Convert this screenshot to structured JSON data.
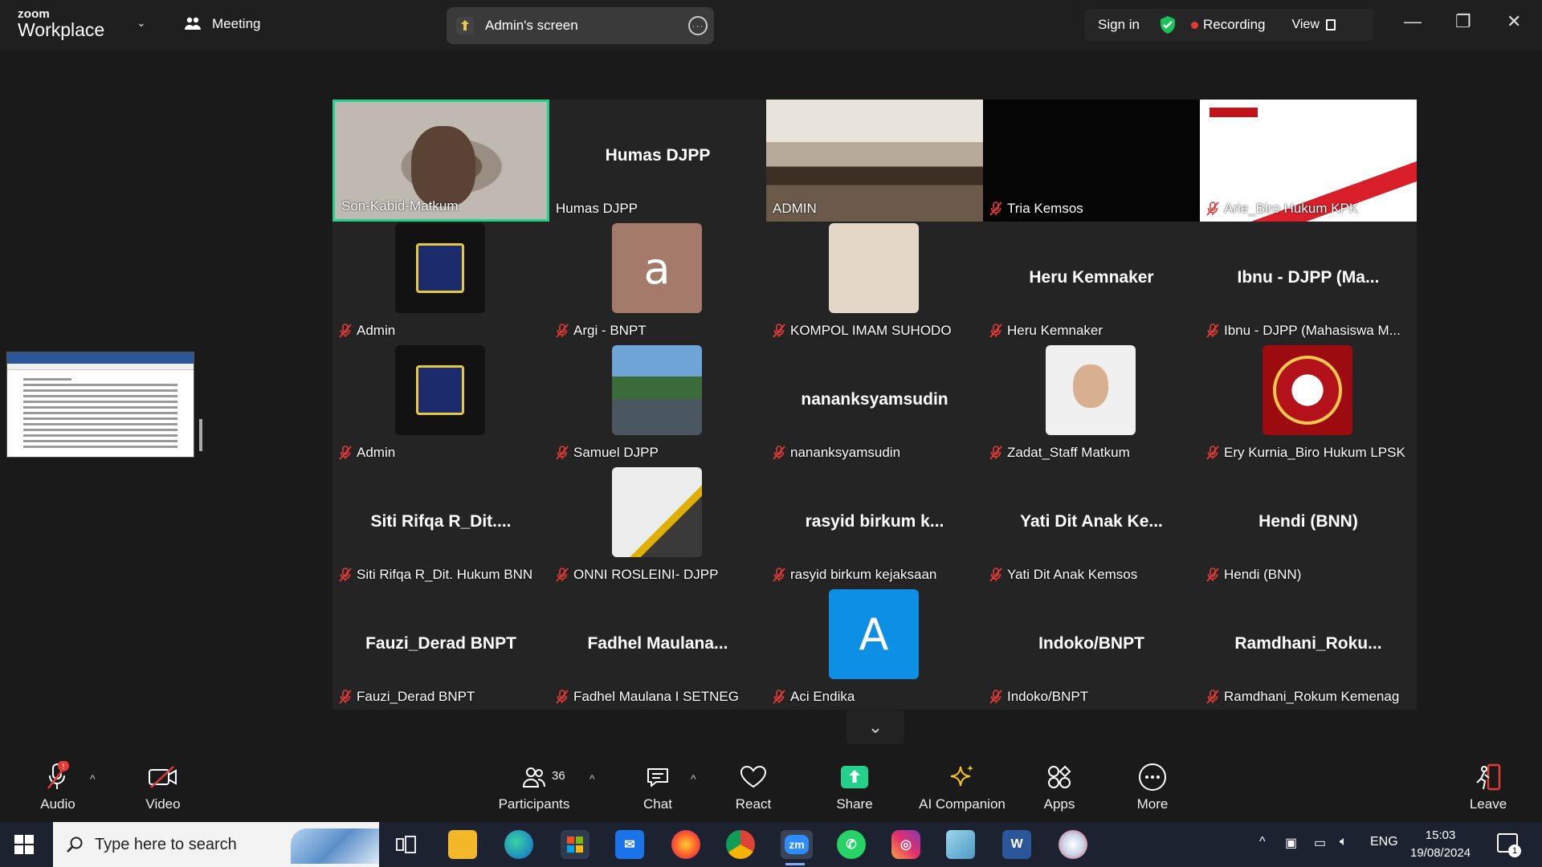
{
  "titlebar": {
    "brand_top": "zoom",
    "brand_bottom": "Workplace",
    "meeting_label": "Meeting",
    "shared_screen": "Admin's screen",
    "sign_in": "Sign in",
    "recording": "Recording",
    "view": "View"
  },
  "grid": {
    "tiles": [
      {
        "label": "Son-Kabid-Matkum",
        "muted": false,
        "type": "video",
        "active": true
      },
      {
        "label": "Humas DJPP",
        "center": "Humas DJPP",
        "muted": false,
        "type": "name"
      },
      {
        "label": "ADMIN",
        "muted": false,
        "type": "video"
      },
      {
        "label": "Tria Kemsos",
        "muted": true,
        "type": "dark"
      },
      {
        "label": "Arie_Biro Hukum KPK",
        "muted": true,
        "type": "kpk"
      },
      {
        "label": "Admin",
        "muted": true,
        "type": "logo"
      },
      {
        "label": "Argi - BNPT",
        "muted": true,
        "type": "letter",
        "letter": "a",
        "color": "#a47a6a"
      },
      {
        "label": "KOMPOL IMAM SUHODO",
        "muted": true,
        "type": "beige"
      },
      {
        "label": "Heru Kemnaker",
        "center": "Heru Kemnaker",
        "muted": true,
        "type": "name"
      },
      {
        "label": "Ibnu - DJPP (Mahasiswa M...",
        "center": "Ibnu - DJPP (Ma...",
        "muted": true,
        "type": "name"
      },
      {
        "label": "Admin",
        "muted": true,
        "type": "logo"
      },
      {
        "label": "Samuel DJPP",
        "muted": true,
        "type": "photo"
      },
      {
        "label": "nananksyamsudin",
        "center": "nananksyamsudin",
        "muted": true,
        "type": "name"
      },
      {
        "label": "Zadat_Staff Matkum",
        "muted": true,
        "type": "person"
      },
      {
        "label": "Ery Kurnia_Biro Hukum LPSK",
        "muted": true,
        "type": "seal"
      },
      {
        "label": "Siti Rifqa R_Dit. Hukum BNN",
        "center": "Siti Rifqa R_Dit....",
        "muted": true,
        "type": "name"
      },
      {
        "label": "ONNI ROSLEINI- DJPP",
        "muted": true,
        "type": "building"
      },
      {
        "label": "rasyid birkum kejaksaan",
        "center": "rasyid birkum k...",
        "muted": true,
        "type": "name"
      },
      {
        "label": "Yati Dit Anak Kemsos",
        "center": "Yati Dit Anak Ke...",
        "muted": true,
        "type": "name"
      },
      {
        "label": "Hendi (BNN)",
        "center": "Hendi (BNN)",
        "muted": true,
        "type": "name"
      },
      {
        "label": "Fauzi_Derad BNPT",
        "center": "Fauzi_Derad BNPT",
        "muted": true,
        "type": "name"
      },
      {
        "label": "Fadhel Maulana I SETNEG",
        "center": "Fadhel Maulana...",
        "muted": true,
        "type": "name"
      },
      {
        "label": "Aci Endika",
        "muted": true,
        "type": "letter",
        "letter": "A",
        "color": "#0e8fe6"
      },
      {
        "label": "Indoko/BNPT",
        "center": "Indoko/BNPT",
        "muted": true,
        "type": "name"
      },
      {
        "label": "Ramdhani_Rokum Kemenag",
        "center": "Ramdhani_Roku...",
        "muted": true,
        "type": "name"
      }
    ]
  },
  "toolbar": {
    "audio": "Audio",
    "video": "Video",
    "participants": "Participants",
    "participants_count": "36",
    "chat": "Chat",
    "react": "React",
    "share": "Share",
    "ai": "AI Companion",
    "apps": "Apps",
    "more": "More",
    "leave": "Leave"
  },
  "taskbar": {
    "search_placeholder": "Type here to search",
    "lang": "ENG",
    "time": "15:03",
    "date": "19/08/2024",
    "notif_count": "1"
  },
  "colors": {
    "active_border": "#23d18b",
    "share_green": "#23d18b",
    "recording_red": "#e53935"
  }
}
